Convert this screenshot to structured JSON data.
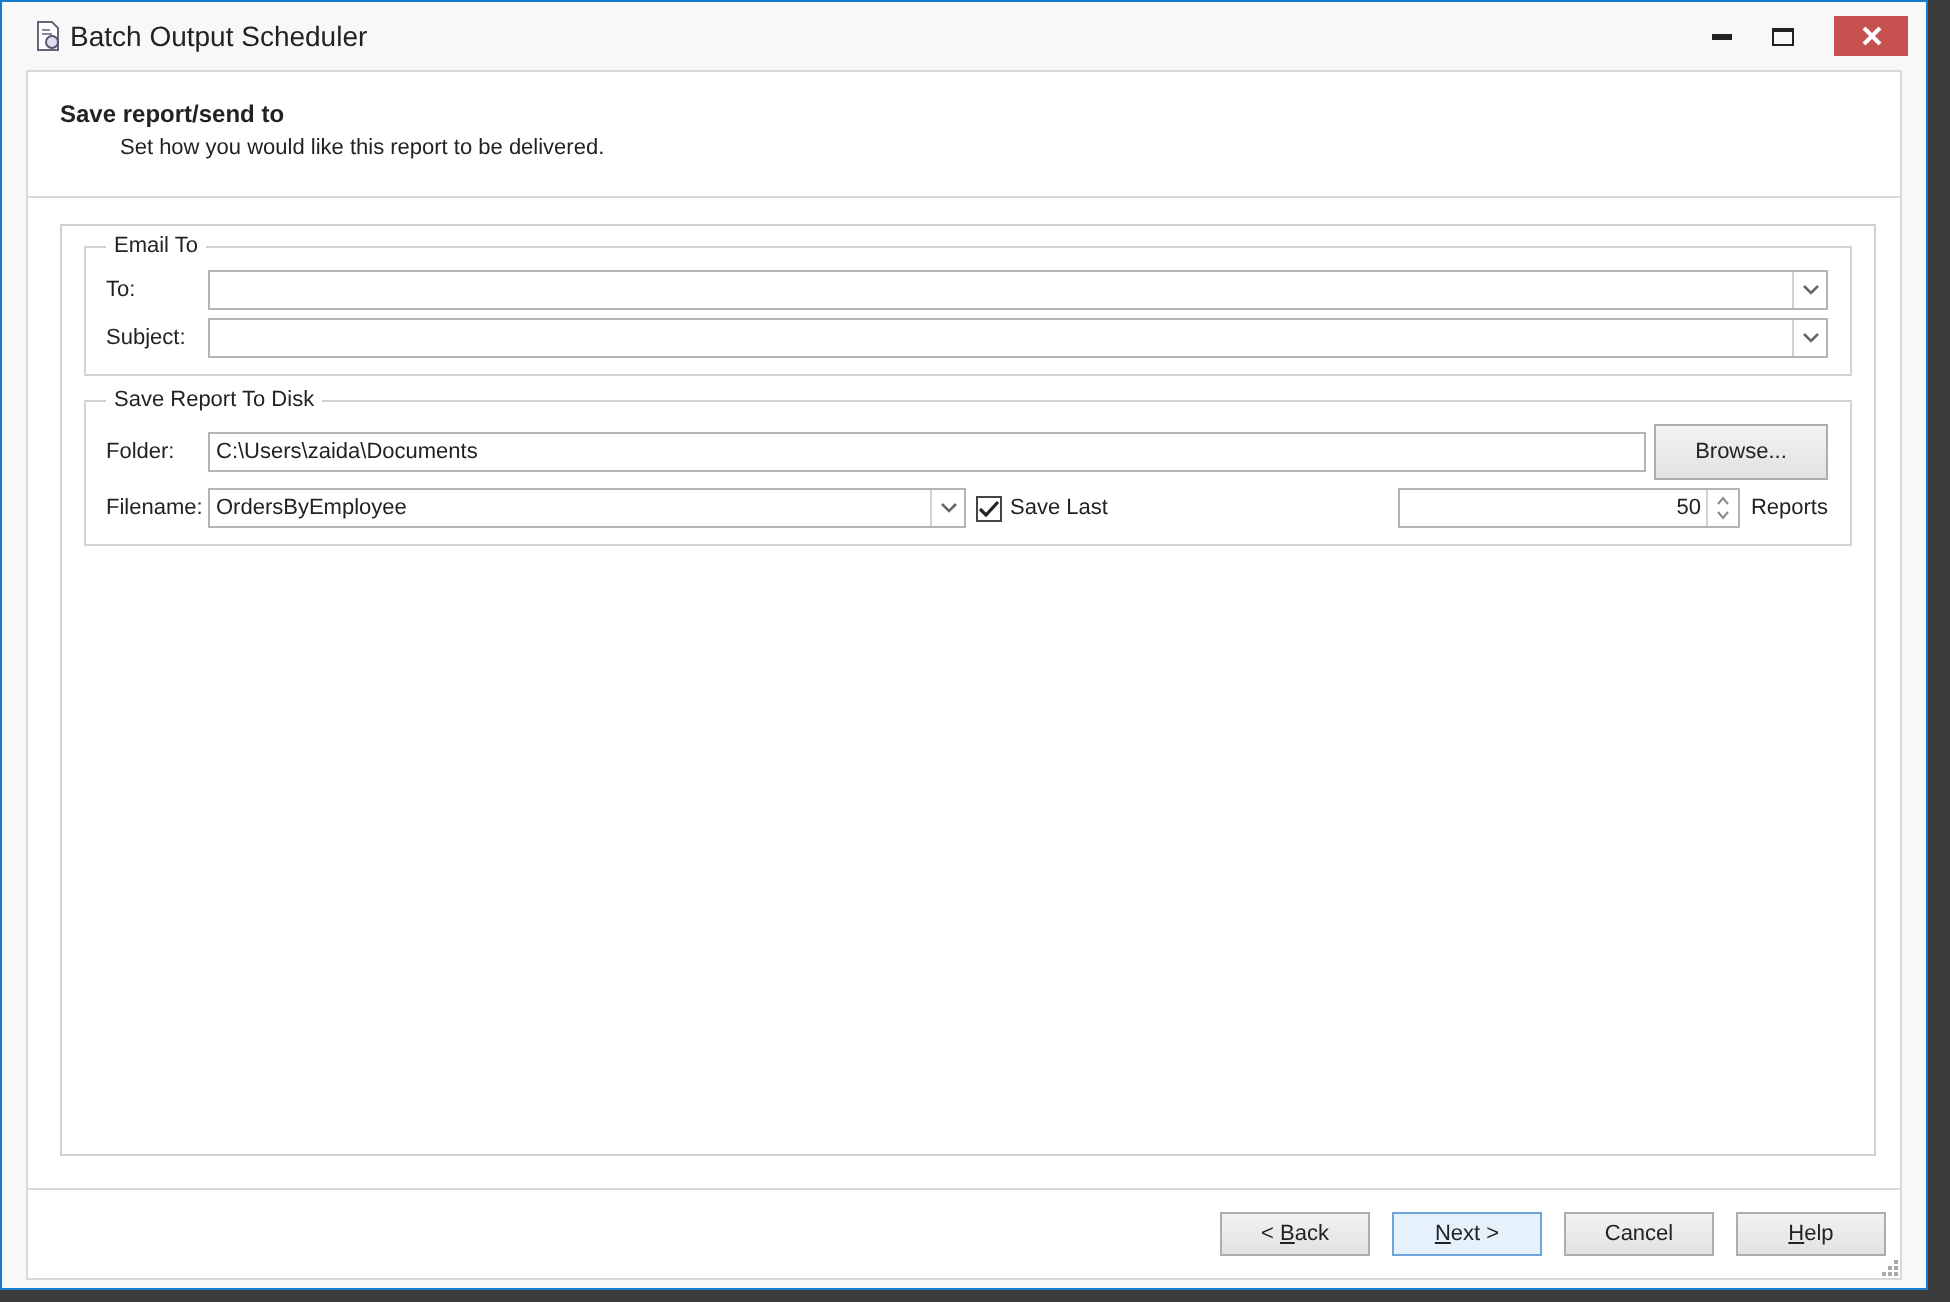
{
  "window": {
    "title": "Batch Output Scheduler"
  },
  "header": {
    "title": "Save report/send to",
    "subtitle": "Set how you would like this report to be delivered."
  },
  "email_group": {
    "legend": "Email To",
    "fields": [
      {
        "label": "To:"
      },
      {
        "label": "Subject:"
      }
    ]
  },
  "disk_group": {
    "legend": "Save Report To Disk",
    "folder": {
      "label": "Folder:",
      "value": "C:\\Users\\zaida\\Documents",
      "button": "Browse..."
    },
    "filename": {
      "label": "Filename:",
      "value": "OrdersByEmployee"
    },
    "save_last": {
      "label": "Save Last",
      "checked": true
    },
    "count": {
      "value": "50",
      "unit": "Reports"
    }
  },
  "buttons": [
    {
      "before": "< ",
      "access_key": "B",
      "after": "ack",
      "selected": false
    },
    {
      "access_key": "N",
      "after": "ext >",
      "selected": true
    },
    {
      "before": "Cancel",
      "selected": false
    },
    {
      "access_key": "H",
      "after": "elp",
      "selected": false
    }
  ]
}
